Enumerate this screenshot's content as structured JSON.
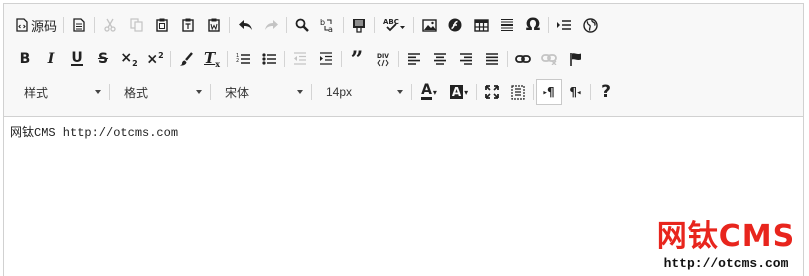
{
  "toolbar": {
    "source_label": "源码",
    "styles_label": "样式",
    "format_label": "格式",
    "font_family_value": "宋体",
    "font_size_value": "14px"
  },
  "content": {
    "text": "网钛CMS http://otcms.com"
  },
  "watermark": {
    "logo": "网钛CMS",
    "url": "http://otcms.com"
  },
  "colors": {
    "toolbar_bg": "#f8f8f8",
    "border": "#d1d1d1",
    "watermark_red": "#e8251d",
    "disabled_icon": "#c4c4c4"
  }
}
